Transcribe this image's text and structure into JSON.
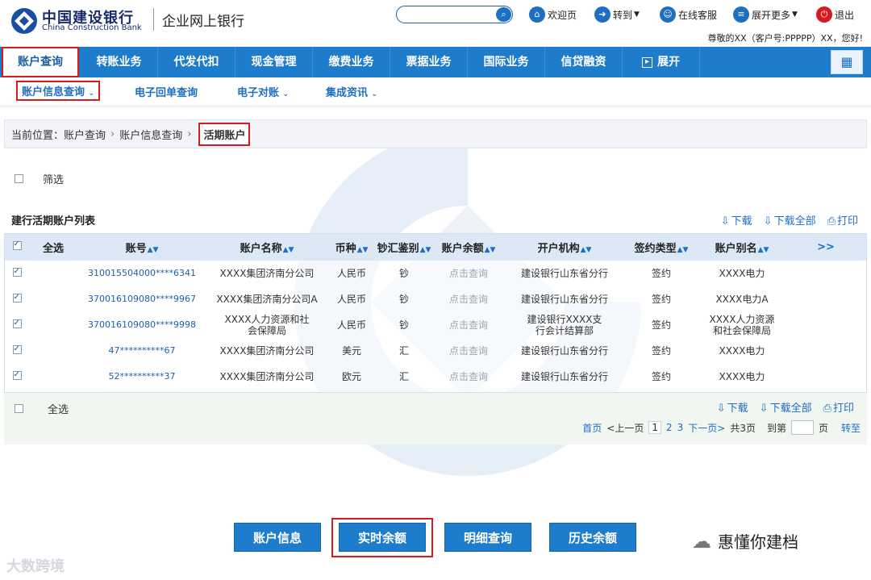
{
  "header": {
    "bank_name_cn": "中国建设银行",
    "bank_name_en": "China Construction Bank",
    "portal_title": "企业网上银行",
    "search_placeholder": "",
    "links": {
      "welcome": "欢迎页",
      "goto": "转到",
      "service": "在线客服",
      "more": "展开更多",
      "logout": "退出"
    },
    "greeting": "尊敬的XX（客户号:PPPPP）XX，您好!"
  },
  "main_nav": {
    "items": [
      "账户查询",
      "转账业务",
      "代发代扣",
      "现金管理",
      "缴费业务",
      "票据业务",
      "国际业务",
      "信贷融资"
    ],
    "expand": "展开",
    "active_index": 0
  },
  "sub_nav": {
    "items": [
      "账户信息查询",
      "电子回单查询",
      "电子对账",
      "集成资讯"
    ]
  },
  "breadcrumb": {
    "label": "当前位置：",
    "path": [
      "账户查询",
      "账户信息查询"
    ],
    "current": "活期账户"
  },
  "filter": {
    "label": "筛选"
  },
  "list": {
    "title": "建行活期账户列表",
    "actions": {
      "download": "下载",
      "download_all": "下载全部",
      "print": "打印"
    },
    "select_all": "全选",
    "more": ">>",
    "columns": [
      "账号",
      "账户名称",
      "币种",
      "钞汇鉴别",
      "账户余额",
      "开户机构",
      "签约类型",
      "账户别名"
    ],
    "rows": [
      {
        "account": "310015504000****6341",
        "name": "XXXX集团济南分公司",
        "currency": "人民币",
        "cash": "钞",
        "balance": "点击查询",
        "branch": "建设银行山东省分行",
        "sign": "签约",
        "alias": "XXXX电力"
      },
      {
        "account": "370016109080****9967",
        "name": "XXXX集团济南分公司A",
        "currency": "人民币",
        "cash": "钞",
        "balance": "点击查询",
        "branch": "建设银行山东省分行",
        "sign": "签约",
        "alias": "XXXX电力A"
      },
      {
        "account": "370016109080****9998",
        "name": "XXXX人力资源和社会保障局",
        "currency": "人民币",
        "cash": "钞",
        "balance": "点击查询",
        "branch": "建设银行XXXX支行会计结算部",
        "sign": "签约",
        "alias": "XXXX人力资源和社会保障局"
      },
      {
        "account": "47**********67",
        "name": "XXXX集团济南分公司",
        "currency": "美元",
        "cash": "汇",
        "balance": "点击查询",
        "branch": "建设银行山东省分行",
        "sign": "签约",
        "alias": "XXXX电力"
      },
      {
        "account": "52**********37",
        "name": "XXXX集团济南分公司",
        "currency": "欧元",
        "cash": "汇",
        "balance": "点击查询",
        "branch": "建设银行山东省分行",
        "sign": "签约",
        "alias": "XXXX电力"
      }
    ]
  },
  "pager": {
    "first": "首页",
    "prev": "<上一页",
    "pages": [
      "1",
      "2",
      "3"
    ],
    "next": "下一页>",
    "total": "共3页",
    "goto_label": "到第",
    "page_unit": "页",
    "go": "转至"
  },
  "bottom_buttons": [
    "账户信息",
    "实时余额",
    "明细查询",
    "历史余额"
  ],
  "footer": {
    "wechat_name": "惠懂你建档",
    "watermark": "大数跨境"
  },
  "colors": {
    "nav_blue": "#1e7ccd",
    "link_blue": "#1e6ec1",
    "highlight_red": "#d71920",
    "brand_navy": "#1a2b6b"
  }
}
